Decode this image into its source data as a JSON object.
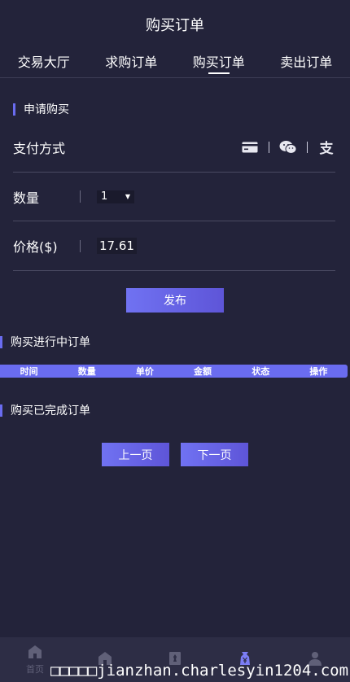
{
  "header": {
    "title": "购买订单"
  },
  "tabs": [
    {
      "label": "交易大厅"
    },
    {
      "label": "求购订单"
    },
    {
      "label": "购买订单"
    },
    {
      "label": "卖出订单"
    }
  ],
  "apply": {
    "title": "申请购买",
    "pay_label": "支付方式",
    "pay_icons": [
      "card-icon",
      "wechat-icon",
      "alipay-icon"
    ],
    "alipay_glyph": "支",
    "qty_label": "数量",
    "qty_value": "1",
    "qty_caret": "▼",
    "price_label": "价格($)",
    "price_value": "17.61",
    "publish_label": "发布"
  },
  "ongoing": {
    "title": "购买进行中订单",
    "columns": [
      "时间",
      "数量",
      "单价",
      "金额",
      "状态",
      "操作"
    ]
  },
  "done": {
    "title": "购买已完成订单"
  },
  "pager": {
    "prev": "上一页",
    "next": "下一页"
  },
  "nav": [
    {
      "label": "首页",
      "icon": "home-icon"
    },
    {
      "label": "",
      "icon": "home-icon"
    },
    {
      "label": "",
      "icon": "chess-icon"
    },
    {
      "label": "",
      "icon": "yen-bag-icon"
    },
    {
      "label": "",
      "icon": "user-icon"
    }
  ],
  "watermark": "□□□□□jianzhan.charlesyin1204.com",
  "colors": {
    "background": "#23233a",
    "accent": "#6a6cf0",
    "nav_bg": "#2d2d45"
  }
}
